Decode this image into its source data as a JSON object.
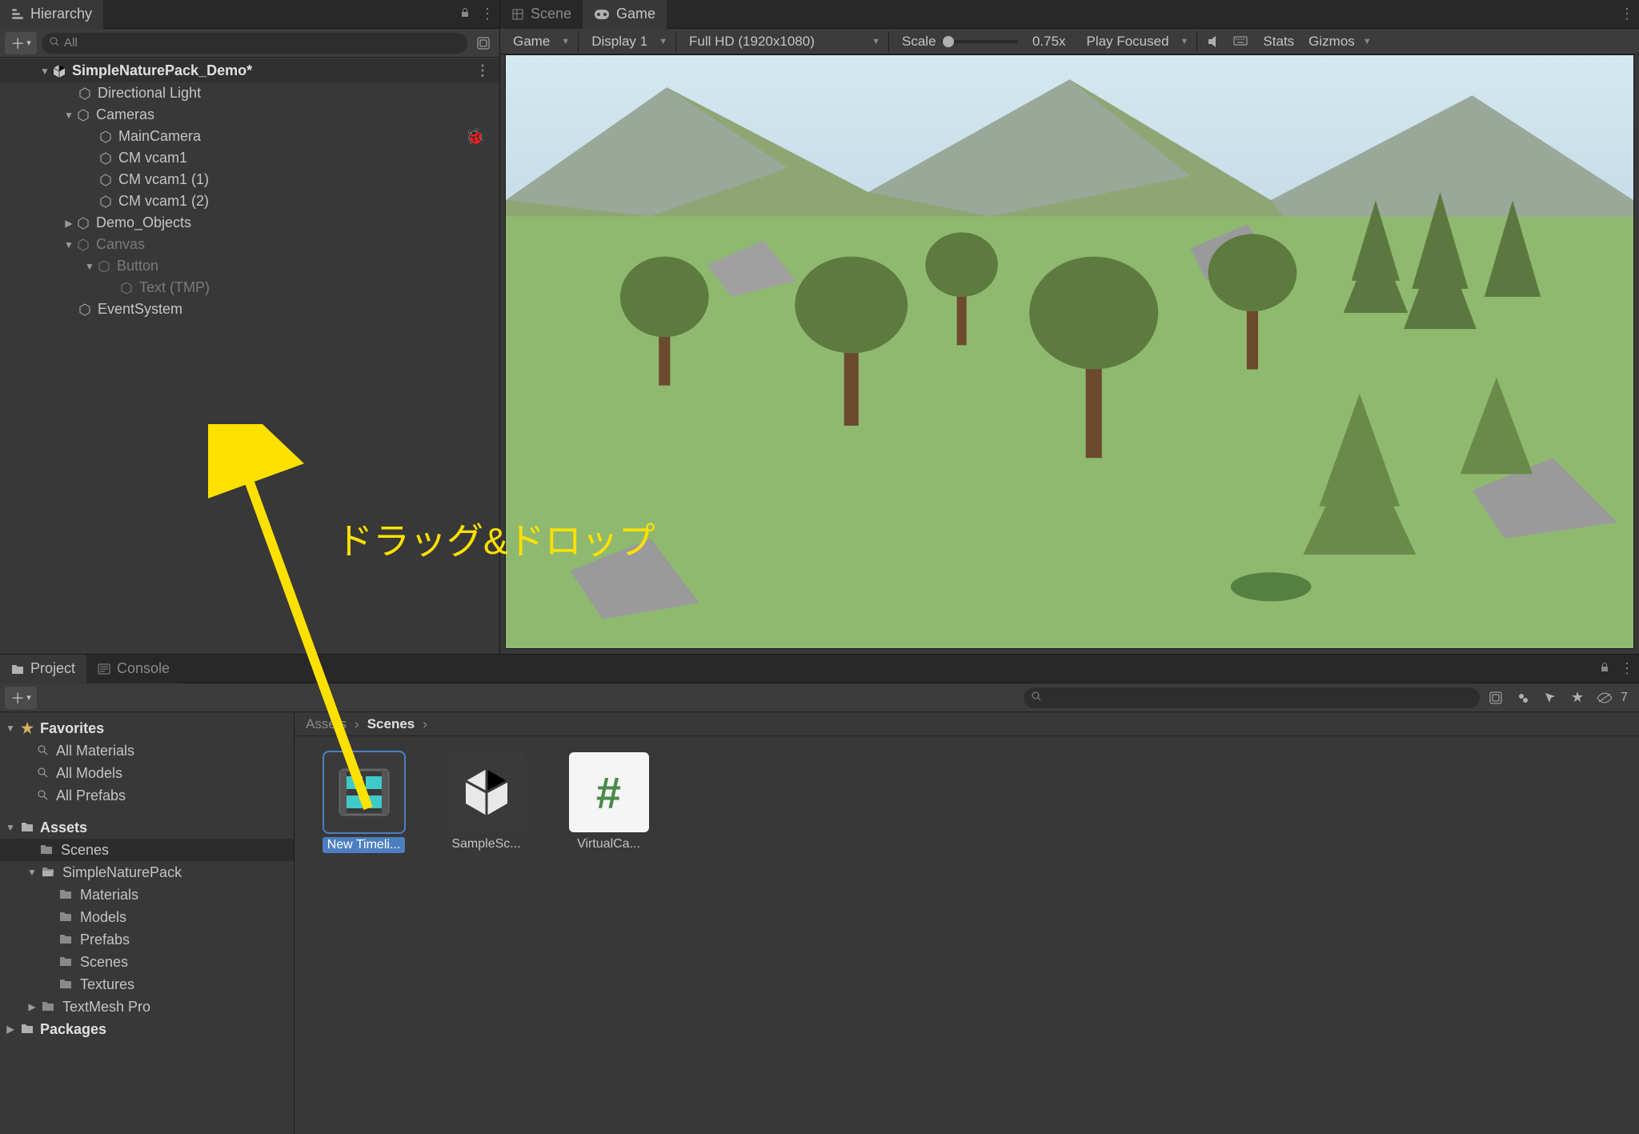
{
  "hierarchy": {
    "title": "Hierarchy",
    "searchPlaceholder": "All",
    "scene": "SimpleNaturePack_Demo*",
    "nodes": {
      "directionalLight": "Directional Light",
      "cameras": "Cameras",
      "mainCamera": "MainCamera",
      "cmvcam1": "CM vcam1",
      "cmvcam1_1": "CM vcam1 (1)",
      "cmvcam1_2": "CM vcam1 (2)",
      "demoObjects": "Demo_Objects",
      "canvas": "Canvas",
      "button": "Button",
      "textTMP": "Text (TMP)",
      "eventSystem": "EventSystem"
    }
  },
  "gamePanel": {
    "tabs": {
      "scene": "Scene",
      "game": "Game"
    },
    "toolbar": {
      "mode": "Game",
      "display": "Display 1",
      "resolution": "Full HD (1920x1080)",
      "scaleLabel": "Scale",
      "scaleValue": "0.75x",
      "playMode": "Play Focused",
      "stats": "Stats",
      "gizmos": "Gizmos"
    }
  },
  "project": {
    "tabs": {
      "project": "Project",
      "console": "Console"
    },
    "favorites": {
      "header": "Favorites",
      "allMaterials": "All Materials",
      "allModels": "All Models",
      "allPrefabs": "All Prefabs"
    },
    "assetsHeader": "Assets",
    "folders": {
      "scenes": "Scenes",
      "simpleNaturePack": "SimpleNaturePack",
      "materials": "Materials",
      "models": "Models",
      "prefabs": "Prefabs",
      "scenes2": "Scenes",
      "textures": "Textures",
      "textMeshPro": "TextMesh Pro",
      "packages": "Packages"
    },
    "breadcrumb": {
      "root": "Assets",
      "current": "Scenes"
    },
    "assets": {
      "newTimeline": "New Timeli...",
      "sampleScene": "SampleSc...",
      "virtualCa": "VirtualCa..."
    },
    "hiddenCount": "7"
  },
  "annotation": {
    "text": "ドラッグ&ドロップ"
  }
}
